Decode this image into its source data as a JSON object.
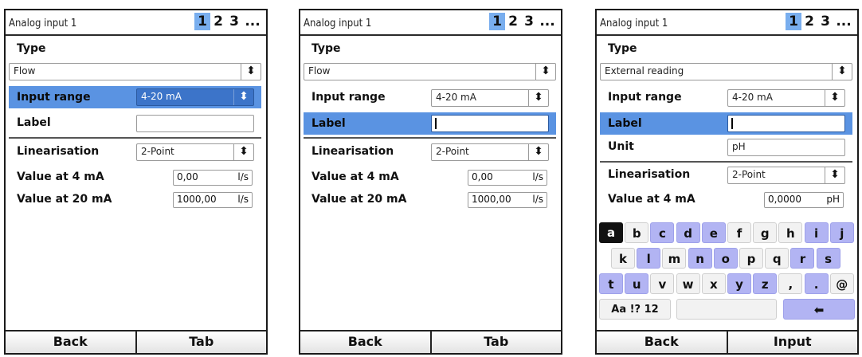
{
  "header": {
    "title": "Analog input 1",
    "pages": [
      "1",
      "2",
      "3",
      "..."
    ]
  },
  "labels": {
    "type": "Type",
    "input_range": "Input range",
    "label": "Label",
    "unit": "Unit",
    "linearisation": "Linearisation",
    "value_4ma": "Value at 4 mA",
    "value_20ma": "Value at 20 mA"
  },
  "screens": [
    {
      "type_value": "Flow",
      "input_range_value": "4-20 mA",
      "label_value": "",
      "linearisation_value": "2-Point",
      "value_4ma": "0,00",
      "unit_4ma": "l/s",
      "value_20ma": "1000,00",
      "unit_20ma": "l/s",
      "selected_row": "Input range",
      "footer": [
        "Back",
        "Tab"
      ]
    },
    {
      "type_value": "Flow",
      "input_range_value": "4-20 mA",
      "label_value": "",
      "linearisation_value": "2-Point",
      "value_4ma": "0,00",
      "unit_4ma": "l/s",
      "value_20ma": "1000,00",
      "unit_20ma": "l/s",
      "selected_row": "Label",
      "footer": [
        "Back",
        "Tab"
      ]
    },
    {
      "type_value": "External reading",
      "input_range_value": "4-20 mA",
      "label_value": "",
      "unit_value": "pH",
      "linearisation_value": "2-Point",
      "value_4ma": "0,0000",
      "unit_4ma": "pH",
      "selected_row": "Label",
      "footer": [
        "Back",
        "Input"
      ]
    }
  ],
  "keyboard": {
    "row1": [
      "a",
      "b",
      "c",
      "d",
      "e",
      "f",
      "g",
      "h",
      "i",
      "j"
    ],
    "row2": [
      "k",
      "l",
      "m",
      "n",
      "o",
      "p",
      "q",
      "r",
      "s"
    ],
    "row3": [
      "t",
      "u",
      "v",
      "w",
      "x",
      "y",
      "z",
      ",",
      ".",
      "@"
    ],
    "mode_key": "Aa !? 12",
    "backspace_icon": "left-arrow-icon",
    "selected_key": "a"
  },
  "colors": {
    "highlight": "#5a93e2",
    "active_page": "#79aeee",
    "key_accent": "#b2b4f3"
  }
}
